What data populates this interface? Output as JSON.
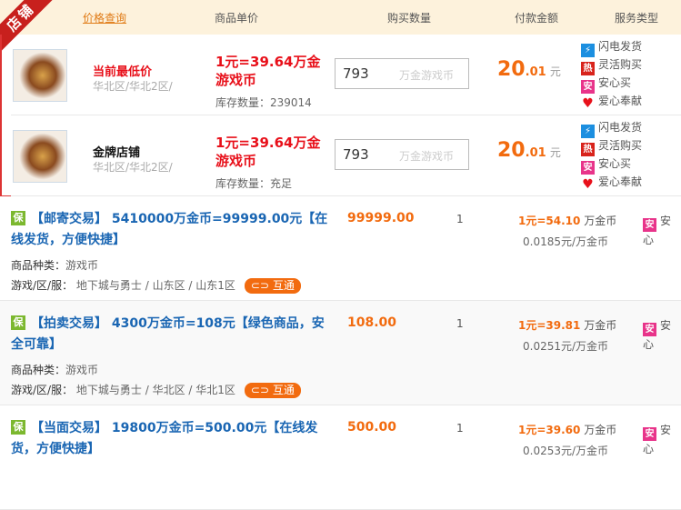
{
  "ribbon": "店铺",
  "header": {
    "query": "价格查询",
    "unit_price": "商品单价",
    "qty": "购买数量",
    "amount": "付款金额",
    "service": "服务类型"
  },
  "top_rows": [
    {
      "title": "当前最低价",
      "title_color": "#e8101a",
      "region": "华北区/华北2区/",
      "price": "1元=39.64万金游戏币",
      "stock": "库存数量：239014",
      "qty": "793",
      "unit": "万金游戏币",
      "amount_int": "20",
      "amount_dec": ".01",
      "amount_unit": "元"
    },
    {
      "title": "金牌店铺",
      "title_color": "#111111",
      "region": "华北区/华北2区/",
      "price": "1元=39.64万金游戏币",
      "stock": "库存数量：充足",
      "qty": "793",
      "unit": "万金游戏币",
      "amount_int": "20",
      "amount_dec": ".01",
      "amount_unit": "元"
    }
  ],
  "services": [
    "闪电发货",
    "灵活购买",
    "安心买",
    "爱心奉献"
  ],
  "service_icons": {
    "lightning": "⚡",
    "hot": "热",
    "safe": "安",
    "heart": "♥"
  },
  "listings": [
    {
      "badge": "保",
      "title": "【邮寄交易】 5410000万金币=99999.00元【在线发货，方便快捷】",
      "kind_label": "商品种类：",
      "kind": "游戏币",
      "server_label": "游戏/区/服：",
      "server": "地下城与勇士 / 山东区 / 山东1区",
      "hutong": "互通",
      "price": "99999.00",
      "qty": "1",
      "rate": "1元=54.10",
      "rate_unit": "万金币",
      "per": "0.0185元/万金币",
      "service": "安心"
    },
    {
      "badge": "保",
      "title": "【拍卖交易】 4300万金币=108元【绿色商品，安全可靠】",
      "kind_label": "商品种类：",
      "kind": "游戏币",
      "server_label": "游戏/区/服：",
      "server": "地下城与勇士 / 华北区 / 华北1区",
      "hutong": "互通",
      "price": "108.00",
      "qty": "1",
      "rate": "1元=39.81",
      "rate_unit": "万金币",
      "per": "0.0251元/万金币",
      "service": "安心"
    },
    {
      "badge": "保",
      "title": "【当面交易】 19800万金币=500.00元【在线发货，方便快捷】",
      "price": "500.00",
      "qty": "1",
      "rate": "1元=39.60",
      "rate_unit": "万金币",
      "per": "0.0253元/万金币",
      "service": "安心"
    }
  ]
}
